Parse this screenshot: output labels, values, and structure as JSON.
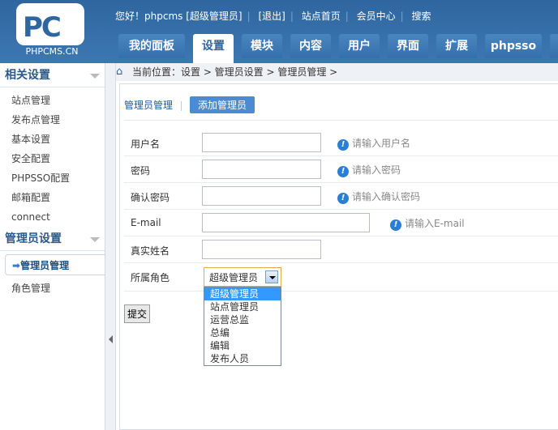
{
  "logo": {
    "text": "PC",
    "caption": "PHPCMS.CN"
  },
  "top_links": [
    "您好！phpcms [超级管理员]",
    "[退出]",
    "站点首页",
    "会员中心",
    "搜索"
  ],
  "tabs": [
    "我的面板",
    "设置",
    "模块",
    "内容",
    "用户",
    "界面",
    "扩展",
    "phpsso"
  ],
  "active_tab": "设置",
  "sidebar": {
    "sections": [
      {
        "title": "相关设置",
        "items": [
          "站点管理",
          "发布点管理",
          "基本设置",
          "安全配置",
          "PHPSSO配置",
          "邮箱配置",
          "connect"
        ]
      },
      {
        "title": "管理员设置",
        "items": [
          "管理员管理",
          "角色管理"
        ]
      }
    ],
    "active_item": "管理员管理"
  },
  "breadcrumb": "当前位置：设置 > 管理员设置 > 管理员管理 >",
  "subnav": {
    "link": "管理员管理",
    "button": "添加管理员"
  },
  "form": {
    "rows": [
      {
        "label": "用户名",
        "hint": "请输入用户名"
      },
      {
        "label": "密码",
        "hint": "请输入密码"
      },
      {
        "label": "确认密码",
        "hint": "请输入确认密码"
      },
      {
        "label": "E-mail",
        "hint": "请输入E-mail"
      },
      {
        "label": "真实姓名",
        "hint": ""
      }
    ],
    "role_label": "所属角色",
    "role_selected": "超级管理员",
    "role_options": [
      "超级管理员",
      "站点管理员",
      "运营总监",
      "总编",
      "编辑",
      "发布人员"
    ],
    "submit": "提交"
  }
}
